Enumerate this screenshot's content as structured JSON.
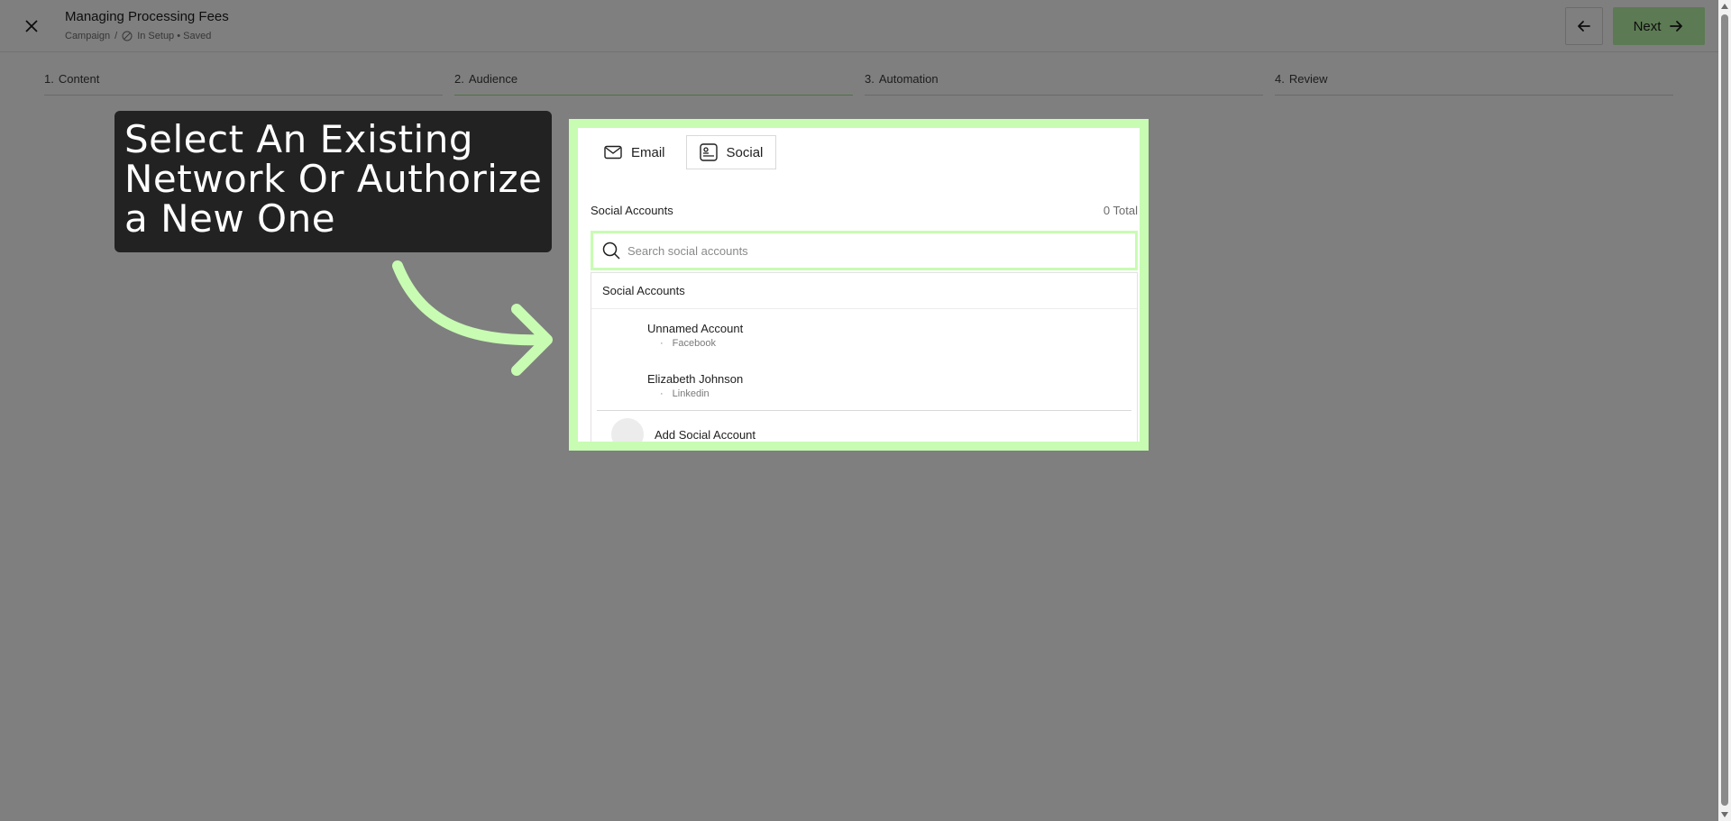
{
  "header": {
    "title": "Managing Processing Fees",
    "breadcrumb_root": "Campaign",
    "breadcrumb_sep": "/",
    "status": "In Setup • Saved",
    "next_label": "Next"
  },
  "steps": [
    {
      "num": "1.",
      "label": "Content"
    },
    {
      "num": "2.",
      "label": "Audience"
    },
    {
      "num": "3.",
      "label": "Automation"
    },
    {
      "num": "4.",
      "label": "Review"
    }
  ],
  "panel": {
    "tabs": [
      {
        "label": "Email",
        "icon": "mail-icon"
      },
      {
        "label": "Social",
        "icon": "social-icon"
      }
    ],
    "section_label": "Social Accounts",
    "total": "0 Total",
    "search_placeholder": "Search social accounts",
    "dropdown_header": "Social Accounts",
    "accounts": [
      {
        "name": "Unnamed Account",
        "network": "Facebook"
      },
      {
        "name": "Elizabeth Johnson",
        "network": "Linkedin"
      }
    ],
    "add_label": "Add Social Account"
  },
  "callout": {
    "text": "Select An Existing Network Or Authorize a New One"
  },
  "colors": {
    "accent": "#c8fcb2",
    "next_bg": "#b9f4a6",
    "callout_bg": "#222222"
  }
}
